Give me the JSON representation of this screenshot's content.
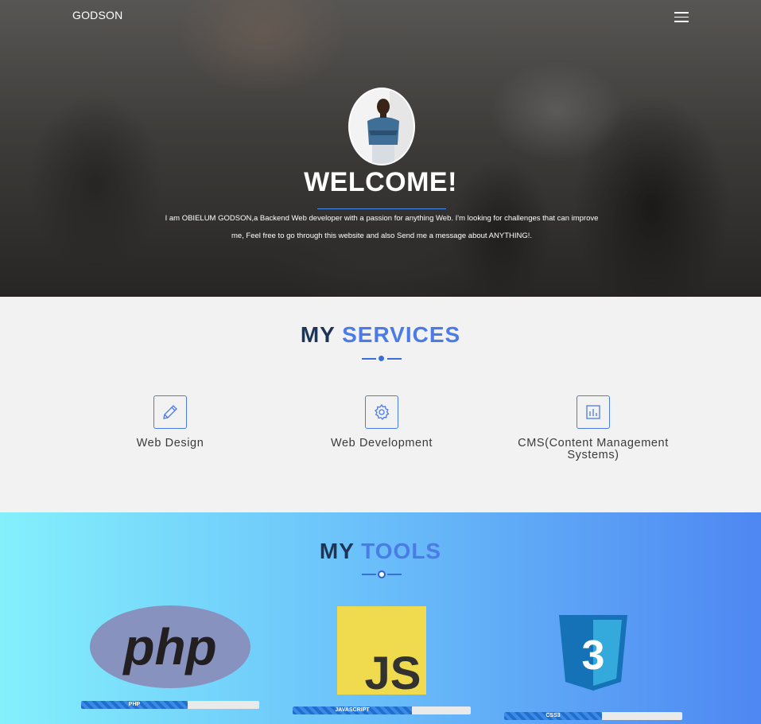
{
  "header": {
    "brand": "GODSON",
    "menu_icon": "hamburger-menu-icon"
  },
  "hero": {
    "title": "WELCOME!",
    "intro_line1": "I am OBIELUM GODSON,a Backend Web developer with a passion for anything Web. I'm looking for challenges that can improve",
    "intro_line2": "me, Feel free to go through this website and also Send me a message about ANYTHING!."
  },
  "services": {
    "title_part1": "MY",
    "title_part2": "SERVICES",
    "items": [
      {
        "label": "Web Design",
        "icon": "pencil-icon"
      },
      {
        "label": "Web Development",
        "icon": "gear-icon"
      },
      {
        "label_line1": "CMS(Content Management",
        "label_line2": "Systems)",
        "icon": "bar-chart-icon"
      }
    ]
  },
  "tools": {
    "title_part1": "MY",
    "title_part2": "TOOLS",
    "items": [
      {
        "name": "PHP",
        "logo_text": "php",
        "level_percent": 60
      },
      {
        "name": "JAVASCRIPT",
        "logo_text": "JS",
        "level_percent": 67
      },
      {
        "name": "CSS3",
        "logo_text": "3",
        "level_percent": 55
      }
    ]
  },
  "colors": {
    "accent": "#4a7be6",
    "title_dark": "#1d3557",
    "php_logo": "#8892bf",
    "js_logo": "#f0db4f",
    "css3_logo": "#1572b6"
  }
}
